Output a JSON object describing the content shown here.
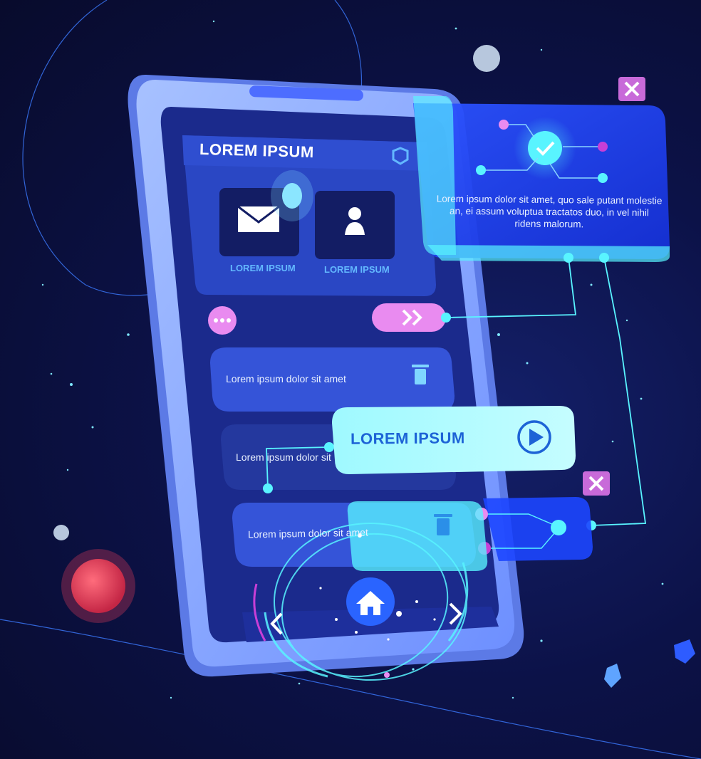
{
  "phone": {
    "header_title": "LOREM IPSUM",
    "tiles": [
      {
        "label": "LOREM IPSUM",
        "icon": "mail-icon"
      },
      {
        "label": "LOREM IPSUM",
        "icon": "user-icon"
      }
    ],
    "rows": [
      {
        "label": "Lorem ipsum dolor sit amet",
        "icon": "trash-icon"
      },
      {
        "label": "Lorem ipsum dolor sit amet",
        "icon": "none"
      },
      {
        "label": "Lorem ipsum dolor sit amet",
        "icon": "trash-icon"
      }
    ],
    "nav_icons": [
      "chevron-left-icon",
      "home-icon",
      "chevron-right-icon"
    ]
  },
  "info_panel": {
    "text": "Lorem ipsum dolor sit amet, quo sale putant molestie an, ei assum voluptua tractatos duo, in vel nihil ridens malorum.",
    "icon": "check-icon"
  },
  "cta_button": {
    "label": "LOREM IPSUM",
    "icon": "play-icon"
  },
  "colors": {
    "background": "#0a0d33",
    "phone_frame": "#8fb0ff",
    "screen": "#1b2a8c",
    "neon_cyan": "#59f4ff",
    "accent_pink": "#e98bf0",
    "close_badge": "#c86ad9"
  }
}
